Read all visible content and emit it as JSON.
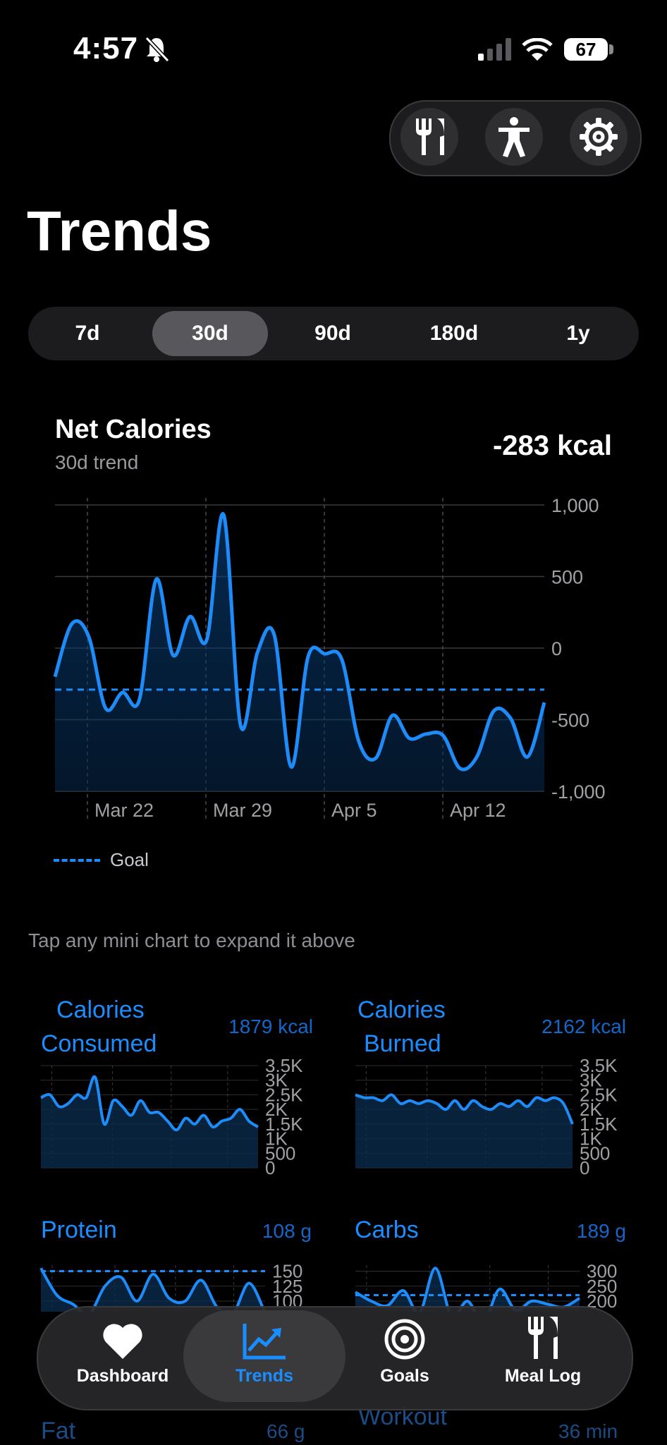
{
  "status_bar": {
    "time": "4:57",
    "battery": "67"
  },
  "toolbar": {
    "icons": [
      "fork-knife-icon",
      "figure-icon",
      "gear-icon"
    ]
  },
  "title": "Trends",
  "ranges": [
    "7d",
    "30d",
    "90d",
    "180d",
    "1y"
  ],
  "selected_range": "30d",
  "net_card": {
    "title": "Net Calories",
    "subtitle": "30d trend",
    "value": "-283 kcal",
    "legend": "Goal"
  },
  "hint": "Tap any mini chart to expand it above",
  "minis": {
    "cal_consumed": {
      "title_line1": "Calories",
      "title_line2": "Consumed",
      "value": "1879 kcal"
    },
    "cal_burned": {
      "title_line1": "Calories",
      "title_line2": "Burned",
      "value": "2162 kcal"
    },
    "protein": {
      "title": "Protein",
      "value": "108 g"
    },
    "carbs": {
      "title": "Carbs",
      "value": "189 g"
    },
    "fat": {
      "title": "Fat",
      "value": "66 g"
    },
    "workout": {
      "title": "Workout",
      "value": "36 min"
    }
  },
  "tabs": [
    {
      "label": "Dashboard",
      "icon": "heart-icon"
    },
    {
      "label": "Trends",
      "icon": "chart-icon"
    },
    {
      "label": "Goals",
      "icon": "target-icon"
    },
    {
      "label": "Meal Log",
      "icon": "fork-knife-icon"
    }
  ],
  "active_tab": "Trends",
  "colors": {
    "accent": "#1a8dff",
    "background": "#000000",
    "card": "#1c1c1e"
  },
  "chart_data": [
    {
      "type": "area",
      "title": "Net Calories",
      "subtitle": "30d trend",
      "xlabel": "",
      "ylabel": "",
      "x_ticks": [
        "Mar 22",
        "Mar 29",
        "Apr 5",
        "Apr 12"
      ],
      "y_ticks": [
        "1,000",
        "500",
        "0",
        "-500",
        "-1,000"
      ],
      "ylim": [
        -1000,
        1000
      ],
      "goal": -290,
      "values": [
        -200,
        170,
        80,
        -420,
        -310,
        -360,
        480,
        -50,
        220,
        60,
        930,
        -540,
        -30,
        90,
        -830,
        -60,
        -40,
        -80,
        -650,
        -770,
        -470,
        -630,
        -600,
        -610,
        -840,
        -760,
        -440,
        -490,
        -760,
        -380
      ],
      "grid": true
    },
    {
      "type": "line",
      "title": "Calories Consumed",
      "ylim": [
        0,
        3500
      ],
      "y_ticks": [
        "3.5K",
        "3K",
        "2.5K",
        "2K",
        "1.5K",
        "1K",
        "500",
        "0"
      ],
      "values": [
        2400,
        2500,
        2100,
        2200,
        2500,
        2400,
        3100,
        1500,
        2300,
        2100,
        1800,
        2300,
        1900,
        1900,
        1600,
        1300,
        1700,
        1500,
        1800,
        1400,
        1600,
        1700,
        2000,
        1600,
        1400
      ]
    },
    {
      "type": "line",
      "title": "Calories Burned",
      "ylim": [
        0,
        3500
      ],
      "y_ticks": [
        "3.5K",
        "3K",
        "2.5K",
        "2K",
        "1.5K",
        "1K",
        "500",
        "0"
      ],
      "values": [
        2500,
        2400,
        2400,
        2300,
        2500,
        2200,
        2300,
        2200,
        2300,
        2200,
        2000,
        2300,
        2000,
        2300,
        2100,
        2000,
        2200,
        2100,
        2300,
        2100,
        2400,
        2300,
        2400,
        2200,
        1500
      ]
    },
    {
      "type": "line",
      "title": "Protein",
      "y_ticks": [
        "150",
        "125",
        "100"
      ],
      "goal": 150,
      "values": [
        155,
        110,
        95,
        78,
        125,
        140,
        100,
        145,
        105,
        100,
        135,
        90,
        80,
        130,
        80
      ]
    },
    {
      "type": "line",
      "title": "Carbs",
      "y_ticks": [
        "300",
        "250",
        "200"
      ],
      "goal": 220,
      "values": [
        230,
        200,
        185,
        235,
        160,
        310,
        150,
        200,
        130,
        240,
        170,
        200,
        190,
        180,
        210
      ]
    }
  ]
}
